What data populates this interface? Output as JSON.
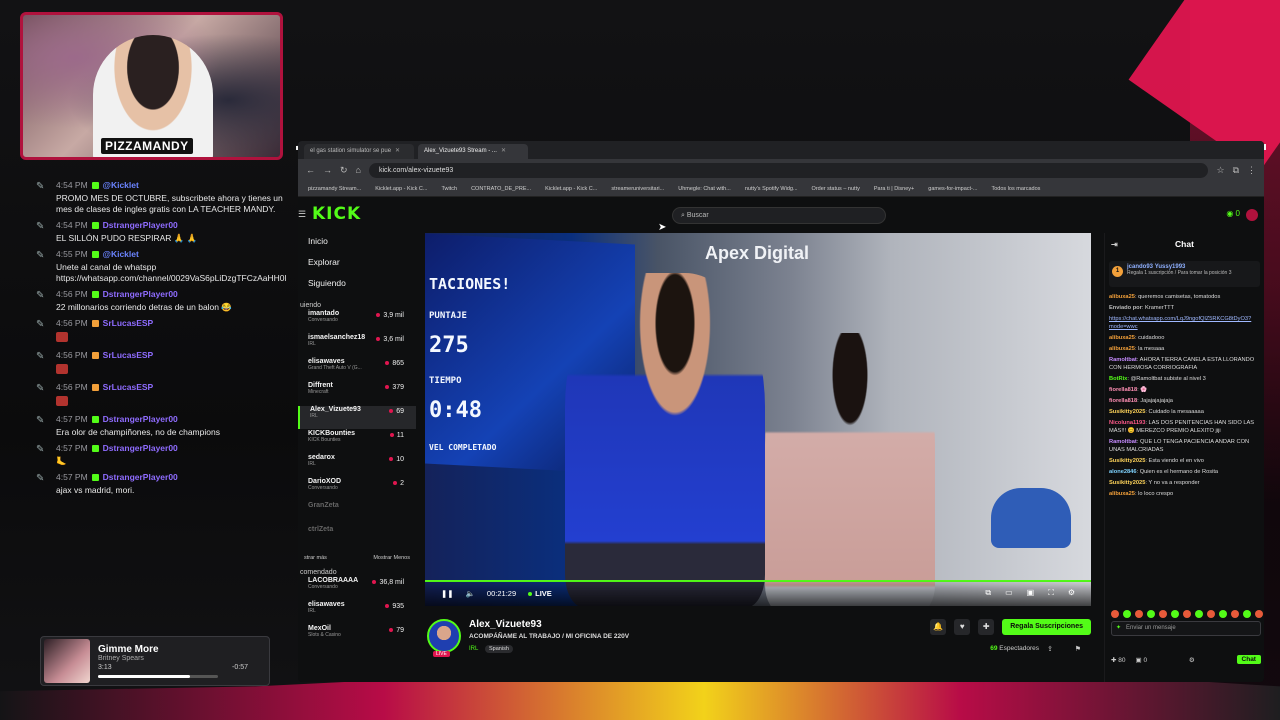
{
  "overlay": {
    "webcam_name": "PIZZAMANDY",
    "chat": [
      {
        "time": "4:54 PM",
        "user": "@Kicklet",
        "text": "PROMO MES DE OCTUBRE, subscribete ahora y tienes un mes de clases de ingles gratis con LA TEACHER MANDY."
      },
      {
        "time": "4:54 PM",
        "user": "DstrangerPlayer00",
        "text": "EL SILLÓN PUDO RESPIRAR 🙏 🙏"
      },
      {
        "time": "4:55 PM",
        "user": "@Kicklet",
        "text": "Unete al canal de whatspp https://whatsapp.com/channel/0029VaS6pLiDzgTFCzAaHH0l"
      },
      {
        "time": "4:56 PM",
        "user": "DstrangerPlayer00",
        "text": "22 millonarios corriendo detras de un balon 😂"
      },
      {
        "time": "4:56 PM",
        "user": "SrLucasESP",
        "text": ""
      },
      {
        "time": "4:56 PM",
        "user": "SrLucasESP",
        "text": ""
      },
      {
        "time": "4:56 PM",
        "user": "SrLucasESP",
        "text": ""
      },
      {
        "time": "4:57 PM",
        "user": "DstrangerPlayer00",
        "text": "Era olor de champiñones, no de champions"
      },
      {
        "time": "4:57 PM",
        "user": "DstrangerPlayer00",
        "text": "🦶"
      },
      {
        "time": "4:57 PM",
        "user": "DstrangerPlayer00",
        "text": "ajax vs madrid, mori."
      }
    ],
    "now_playing": {
      "title": "Gimme More",
      "artist": "Britney Spears",
      "elapsed": "3:13",
      "remaining": "-0:57",
      "progress": 0.77
    }
  },
  "browser": {
    "tabs": [
      {
        "label": "el gas station simulator se pue"
      },
      {
        "label": "Alex_Vizuete93 Stream - ..."
      }
    ],
    "url": "kick.com/alex-vizuete93",
    "bookmarks": [
      "pizzamandy Stream...",
      "Kicklet.app - Kick C...",
      "Twitch",
      "CONTRATO_DE_PRE...",
      "Kicklet.app - Kick C...",
      "streameruniversitari...",
      "Uhmegle: Chat with...",
      "nutty's Spotify Widg...",
      "Order status – nutty",
      "Para ti | Disney+",
      "games-for-impact-...",
      "Todos los marcados"
    ]
  },
  "kick": {
    "logo": "KICK",
    "search_placeholder": "Buscar",
    "header_count": "0",
    "nav": {
      "inicio": "Inicio",
      "explorar": "Explorar",
      "siguiendo": "Siguiendo",
      "section_following": "uiendo",
      "show_more": "strar más",
      "show_less": "Mostrar Menos",
      "section_recommended": "comendado"
    },
    "following": [
      {
        "name": "imantado",
        "game": "Conversando",
        "viewers": "3,9 mil"
      },
      {
        "name": "ismaelsanchez18",
        "game": "IRL",
        "viewers": "3,6 mil"
      },
      {
        "name": "elisawaves",
        "game": "Grand Theft Auto V (G...",
        "viewers": "865"
      },
      {
        "name": "Diffrent",
        "game": "Minecraft",
        "viewers": "379"
      },
      {
        "name": "Alex_Vizuete93",
        "game": "IRL",
        "viewers": "69"
      },
      {
        "name": "KICKBounties",
        "game": "KICK Bounties",
        "viewers": "11"
      },
      {
        "name": "sedarox",
        "game": "IRL",
        "viewers": "10"
      },
      {
        "name": "DarioXOD",
        "game": "Conversando",
        "viewers": "2"
      },
      {
        "name": "GranZeta",
        "game": "",
        "viewers": ""
      },
      {
        "name": "ctrlZeta",
        "game": "",
        "viewers": ""
      }
    ],
    "recommended": [
      {
        "name": "LACOBRAAAA",
        "game": "Conversando",
        "viewers": "36,8 mil"
      },
      {
        "name": "elisawaves",
        "game": "IRL",
        "viewers": "935"
      },
      {
        "name": "MexOil",
        "game": "Slots & Casino",
        "viewers": "79"
      }
    ],
    "player": {
      "time": "00:21:29",
      "live_label": "LIVE",
      "tv_lines": [
        "TACIONES!",
        "PUNTAJE",
        "275",
        "TIEMPO",
        "0:48",
        "VEL COMPLETADO"
      ],
      "wall_logo": "Apex Digital"
    },
    "stream": {
      "channel": "Alex_Vizuete93",
      "title": "ACOMPÁÑAME AL TRABAJO / MI OFICINA DE 220V",
      "category": "IRL",
      "tag": "Spanish",
      "live_badge": "LIVE",
      "subscribe": "Regala Suscripciones",
      "viewers": "69",
      "viewers_label": "Espectadores"
    },
    "chat": {
      "title": "Chat",
      "pinned": {
        "rank": "1",
        "user": "jcando93",
        "user2": "Yussy1993",
        "detail": "Regala 1 suscripción / Para tomar la posición 3"
      },
      "messages": [
        {
          "user": "alibuxa25",
          "color": "#f2a03a",
          "text": "queremos camisetas, tomatodos"
        },
        {
          "user": "Enviado por",
          "color": "#bbb",
          "text": "KramerTTT"
        },
        {
          "user": "",
          "color": "#9fb8ff",
          "text": "https://chat.whatsapp.com/LqJ9ngofQlZ5RKCG8tDyO3?mode=wwc"
        },
        {
          "user": "alibuxa25",
          "color": "#f2a03a",
          "text": "cuidadooo"
        },
        {
          "user": "alibuxa25",
          "color": "#f2a03a",
          "text": "la mesaaa"
        },
        {
          "user": "Ramoltbat",
          "color": "#c68cff",
          "text": "AHORA TIERRA CANELA ESTA LLORANDO CON HERMOSA CORRIOGRAFIA"
        },
        {
          "user": "BotRix",
          "color": "#53fc18",
          "text": "@Ramoltbat subiste al nivel 3"
        },
        {
          "user": "fiorella818",
          "color": "#ff8fb4",
          "text": "🌸"
        },
        {
          "user": "fiorella818",
          "color": "#ff8fb4",
          "text": "Jajajajajajaja"
        },
        {
          "user": "Susikitty2025",
          "color": "#ffd45a",
          "text": "Cuidado la mesaaaaa"
        },
        {
          "user": "Nicoluna1193",
          "color": "#ff5a8a",
          "text": "LAS DOS PENITENCIAS HAN SIDO LAS MÁS!!! 😊 MEREZCO PREMIO ALEXITO jiji"
        },
        {
          "user": "Ramoltbat",
          "color": "#c68cff",
          "text": "QUE LO TENGA PACIENCIA ANDAR CON UNAS MALCRIADAS"
        },
        {
          "user": "Susikitty2025",
          "color": "#ffd45a",
          "text": "Esta viendo el en vivo"
        },
        {
          "user": "alone2846",
          "color": "#7fd3ff",
          "text": "Quien es el hermano de Rosita"
        },
        {
          "user": "Susikitty2025",
          "color": "#ffd45a",
          "text": "Y no va a responder"
        },
        {
          "user": "alibuxa25",
          "color": "#f2a03a",
          "text": "lo loco crespo"
        }
      ],
      "input_placeholder": "Enviar un mensaje",
      "points": "80",
      "gifts": "0",
      "send_label": "Chat"
    }
  }
}
